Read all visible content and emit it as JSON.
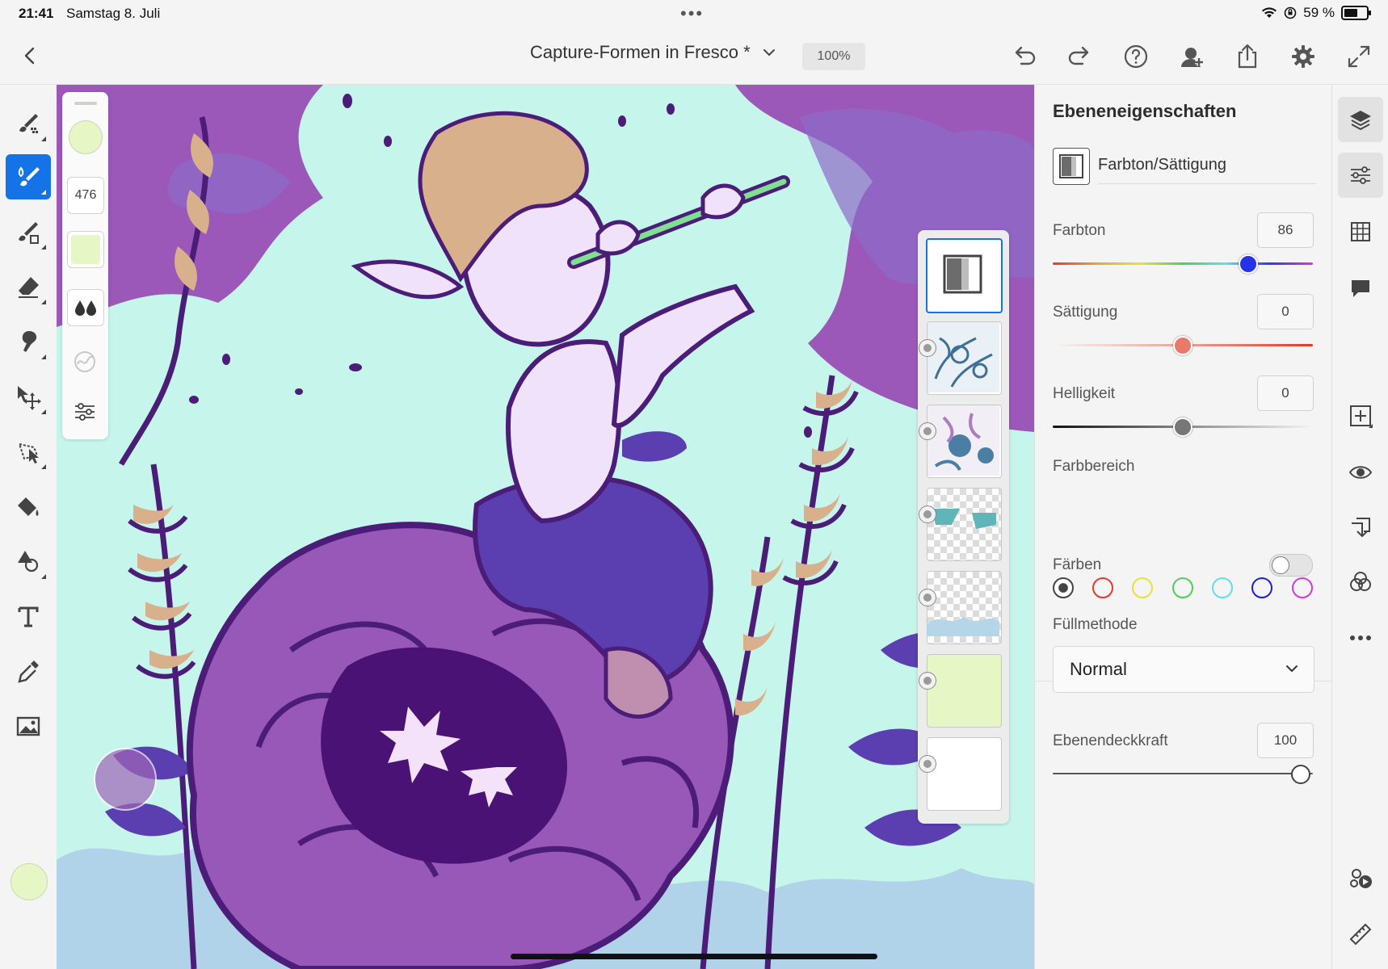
{
  "status": {
    "time": "21:41",
    "date": "Samstag 8. Juli",
    "battery": "59 %"
  },
  "header": {
    "title": "Capture-Formen in Fresco *",
    "zoom": "100%"
  },
  "brush_panel": {
    "size": "476"
  },
  "panel": {
    "title": "Ebeneneigenschaften",
    "adjustment_name": "Farbton/Sättigung",
    "hue_label": "Farbton",
    "hue_value": "86",
    "saturation_label": "Sättigung",
    "saturation_value": "0",
    "lightness_label": "Helligkeit",
    "lightness_value": "0",
    "color_range_label": "Farbbereich",
    "colorize_label": "Färben",
    "blend_label": "Füllmethode",
    "blend_value": "Normal",
    "opacity_label": "Ebenendeckkraft",
    "opacity_value": "100"
  },
  "colors": {
    "accent": "#1473e6",
    "foreground_color": "#e6f6c4"
  },
  "color_range_swatches": [
    "#444444",
    "#e8382c",
    "#e6e23a",
    "#4fcd5a",
    "#5fe0e8",
    "#1c1fd6",
    "#d339e0"
  ]
}
